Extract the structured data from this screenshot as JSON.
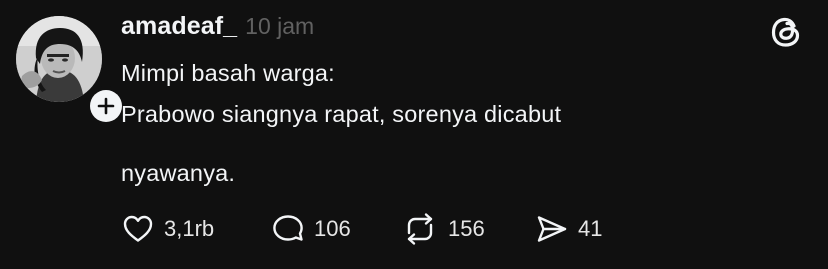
{
  "post": {
    "username": "amadeaf_",
    "timestamp": "10 jam",
    "lines": [
      "Mimpi basah warga:",
      "Prabowo siangnya rapat, sorenya dicabut",
      "nyawanya."
    ],
    "actions": {
      "likes": "3,1rb",
      "replies": "106",
      "reposts": "156",
      "shares": "41"
    }
  },
  "icons": {
    "brand": "threads-logo-icon",
    "follow": "plus-icon",
    "like": "heart-icon",
    "reply": "speech-bubble-icon",
    "repost": "repost-icon",
    "share": "send-icon"
  },
  "colors": {
    "background": "#101010",
    "text": "#f3f5f7",
    "muted": "#616161"
  }
}
